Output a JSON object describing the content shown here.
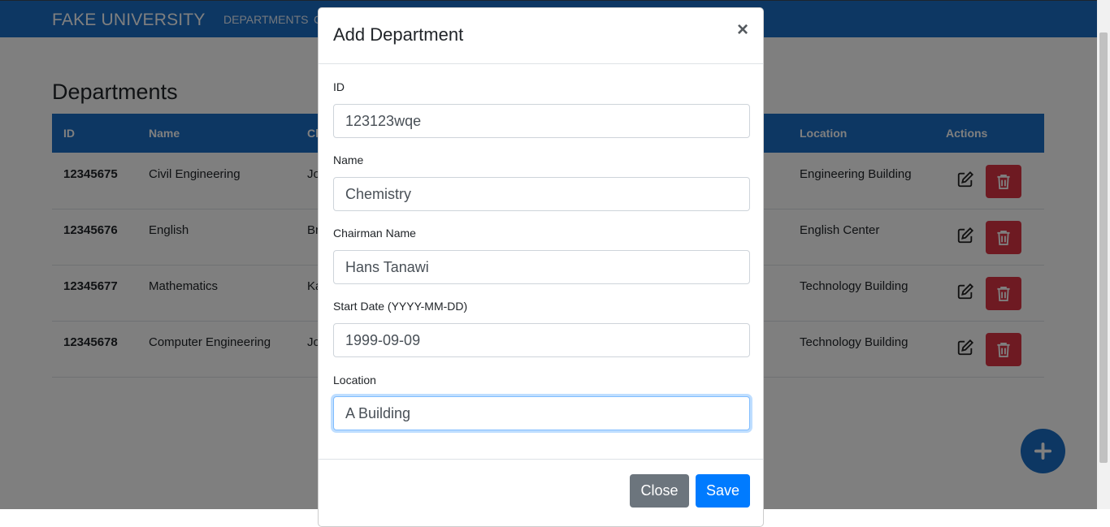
{
  "navbar": {
    "brand": "FAKE UNIVERSITY",
    "links": [
      "DEPARTMENTS",
      "C"
    ]
  },
  "page": {
    "title": "Departments",
    "columns": [
      "ID",
      "Name",
      "Ch",
      "Location",
      "Actions"
    ],
    "rows": [
      {
        "id": "12345675",
        "name": "Civil Engineering",
        "chairman": "Jo",
        "location": "Engineering Building"
      },
      {
        "id": "12345676",
        "name": "English",
        "chairman": "Br",
        "location": "English Center"
      },
      {
        "id": "12345677",
        "name": "Mathematics",
        "chairman": "Ka",
        "location": "Technology Building"
      },
      {
        "id": "12345678",
        "name": "Computer Engineering",
        "chairman": "Jo",
        "location": "Technology Building"
      }
    ]
  },
  "modal": {
    "title": "Add Department",
    "close_symbol": "×",
    "fields": {
      "id": {
        "label": "ID",
        "value": "123123wqe"
      },
      "name": {
        "label": "Name",
        "value": "Chemistry"
      },
      "chairman": {
        "label": "Chairman Name",
        "value": "Hans Tanawi"
      },
      "start_date": {
        "label": "Start Date (YYYY-MM-DD)",
        "value": "1999-09-09"
      },
      "location": {
        "label": "Location",
        "value": "A Building"
      }
    },
    "close_label": "Close",
    "save_label": "Save"
  },
  "colors": {
    "primary": "#1a6ec7",
    "danger": "#dc3545",
    "secondary": "#6c757d",
    "save": "#007bff"
  },
  "icons": {
    "edit": "edit-icon",
    "delete": "trash-icon",
    "add": "plus-icon"
  }
}
